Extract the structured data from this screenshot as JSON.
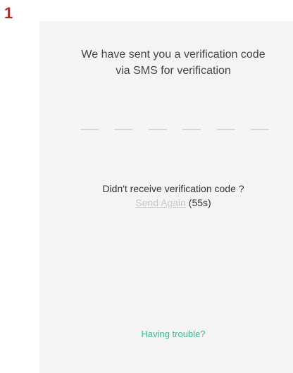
{
  "step_marker": "1",
  "verification": {
    "message_line1": "We have sent you a verification code",
    "message_line2": "via SMS for verification",
    "code_slot_count": 6
  },
  "resend": {
    "prompt": "Didn't receive verification code ?",
    "send_again_label": "Send Again",
    "countdown": "(55s)"
  },
  "help": {
    "trouble_label": "Having trouble?"
  },
  "colors": {
    "step_marker": "#d11a1a",
    "screen_background": "#f4f4f4",
    "text_primary": "#444444",
    "link_disabled": "#c8c8c8",
    "accent_green": "#3fb88c",
    "code_slot": "#d9d9d9"
  }
}
